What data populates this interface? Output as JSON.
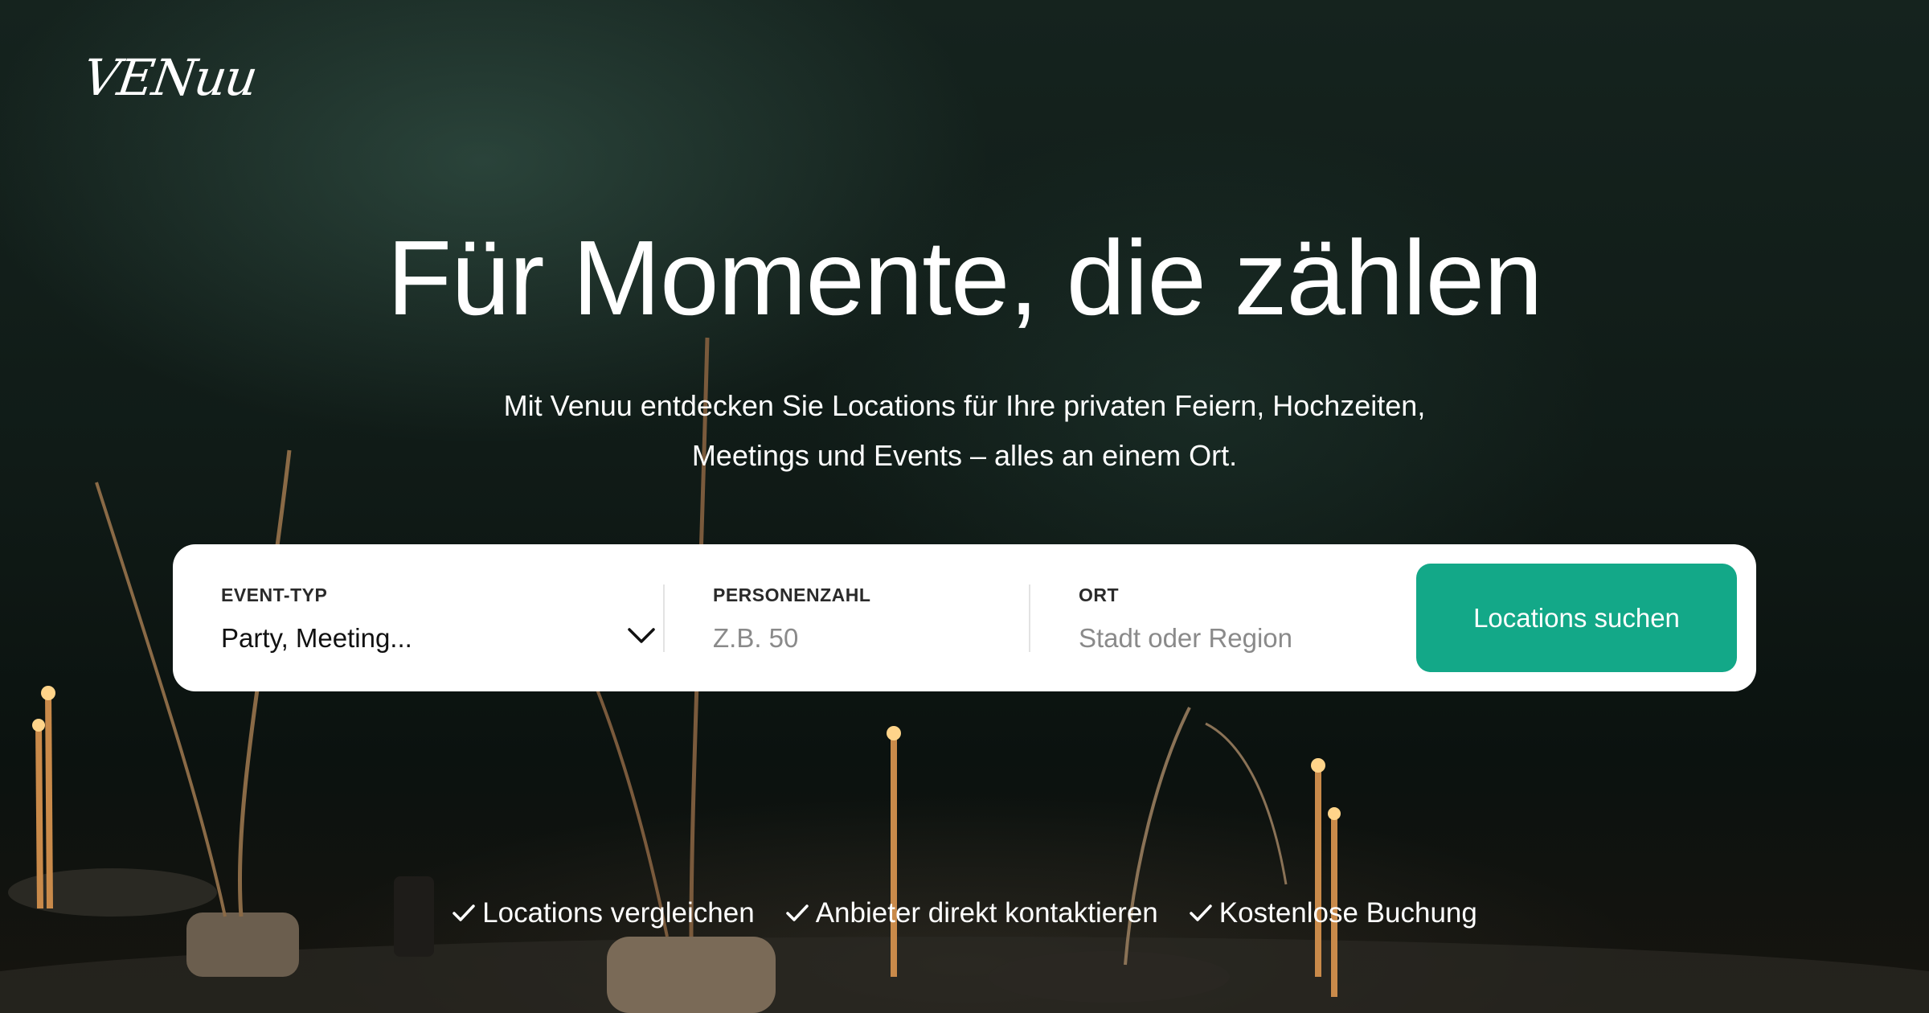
{
  "brand": {
    "logo_text": "VENuu"
  },
  "hero": {
    "headline": "Für Momente, die zählen",
    "subline_line1": "Mit Venuu entdecken Sie Locations für Ihre privaten Feiern, Hochzeiten,",
    "subline_line2": "Meetings und Events – alles an einem Ort."
  },
  "search": {
    "event_type": {
      "label": "EVENT-TYP",
      "value": "Party, Meeting...",
      "icon": "chevron-down-icon"
    },
    "guests": {
      "label": "PERSONENZAHL",
      "placeholder": "Z.B. 50"
    },
    "location": {
      "label": "ORT",
      "placeholder": "Stadt oder Region"
    },
    "button_label": "Locations suchen"
  },
  "benefits": [
    {
      "icon": "check-icon",
      "label": "Locations vergleichen"
    },
    {
      "icon": "check-icon",
      "label": "Anbieter direkt kontaktieren"
    },
    {
      "icon": "check-icon",
      "label": "Kostenlose Buchung"
    }
  ],
  "colors": {
    "accent": "#13a888",
    "panel": "#ffffff",
    "text_on_dark": "#ffffff"
  }
}
